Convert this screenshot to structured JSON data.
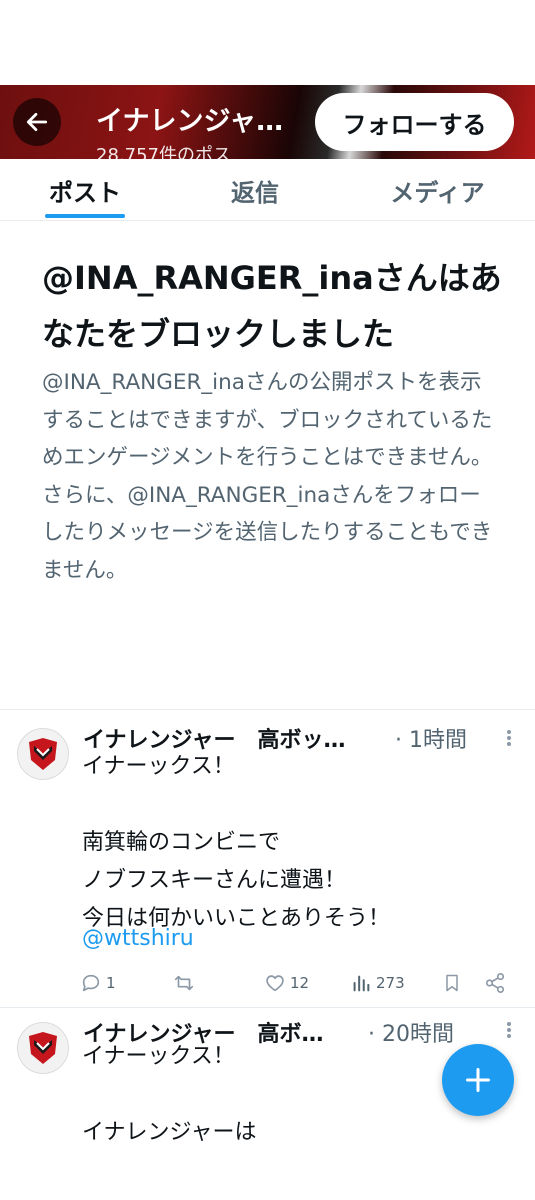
{
  "header": {
    "title": "イナレンジャー…",
    "subtitle": "28,757件のポス",
    "follow_label": "フォローする"
  },
  "tabs": [
    {
      "label": "ポスト",
      "active": true
    },
    {
      "label": "返信",
      "active": false
    },
    {
      "label": "メディア",
      "active": false
    }
  ],
  "blocked": {
    "title": "@INA_RANGER_inaさんはあなたをブロックしました",
    "body": "@INA_RANGER_inaさんの公開ポストを表示することはできますが、ブロックされているためエンゲージメントを行うことはできません。さらに、@INA_RANGER_inaさんをフォローしたりメッセージを送信したりすることもできません。"
  },
  "tweets": [
    {
      "name": "イナレンジャー　高ボッ…",
      "time": "· 1時間",
      "text": "イナーックス！\n\n南箕輪のコンビニで\nノブフスキーさんに遭遇！\n今日は何かいいことありそう！",
      "link": "@wttshiru",
      "replies": "1",
      "retweets": "",
      "likes": "12",
      "views": "273"
    },
    {
      "name": "イナレンジャー　高ボ…",
      "time": "· 20時間",
      "text": "イナーックス！\n\nイナレンジャーは"
    }
  ],
  "colors": {
    "accent": "#1d9bf0",
    "secondary_text": "#536471",
    "header_red": "#8c1414"
  },
  "icons": {
    "back": "arrow-left-icon",
    "more": "more-vertical-icon",
    "reply": "reply-icon",
    "retweet": "retweet-icon",
    "like": "heart-icon",
    "views": "views-chart-icon",
    "bookmark": "bookmark-icon",
    "share": "share-icon",
    "compose": "plus-icon"
  }
}
